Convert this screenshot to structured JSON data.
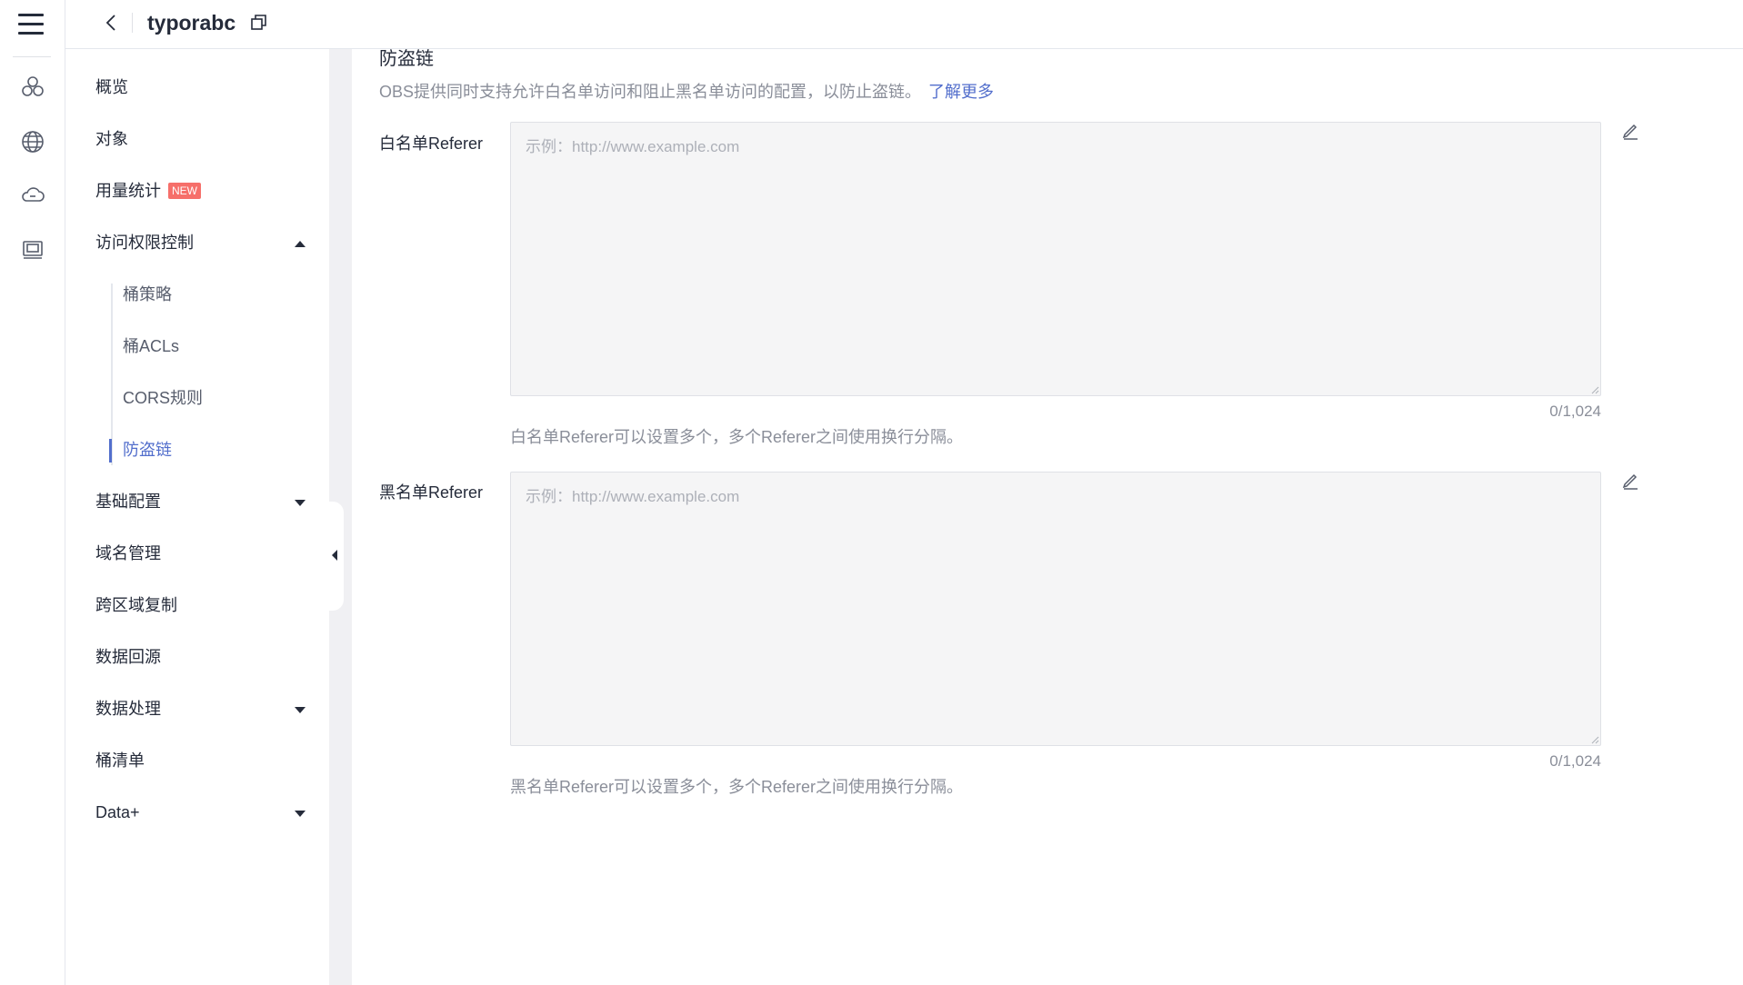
{
  "header": {
    "title": "typorabc"
  },
  "rail": {
    "icons": [
      "menu-icon",
      "cluster-icon",
      "globe-icon",
      "cloud-icon",
      "monitor-icon"
    ]
  },
  "nav": {
    "overview": "概览",
    "objects": "对象",
    "usage": "用量统计",
    "usage_badge": "NEW",
    "access_control": "访问权限控制",
    "access_sub": {
      "bucket_policy": "桶策略",
      "bucket_acls": "桶ACLs",
      "cors_rules": "CORS规则",
      "hotlink": "防盗链"
    },
    "basic_config": "基础配置",
    "domain_mgmt": "域名管理",
    "cross_region": "跨区域复制",
    "data_back_to_source": "数据回源",
    "data_processing": "数据处理",
    "bucket_inventory": "桶清单",
    "data_plus": "Data+"
  },
  "section": {
    "title": "防盗链",
    "description": "OBS提供同时支持允许白名单访问和阻止黑名单访问的配置，以防止盗链。",
    "learn_more": "了解更多"
  },
  "whitelist": {
    "label": "白名单Referer",
    "placeholder": "示例：http://www.example.com",
    "value": "",
    "counter": "0/1,024",
    "hint": "白名单Referer可以设置多个，多个Referer之间使用换行分隔。"
  },
  "blacklist": {
    "label": "黑名单Referer",
    "placeholder": "示例：http://www.example.com",
    "value": "",
    "counter": "0/1,024",
    "hint": "黑名单Referer可以设置多个，多个Referer之间使用换行分隔。"
  },
  "colors": {
    "accent": "#526ecc",
    "badge": "#f66f6a",
    "text": "#252b3a",
    "muted": "#8a8e99"
  }
}
